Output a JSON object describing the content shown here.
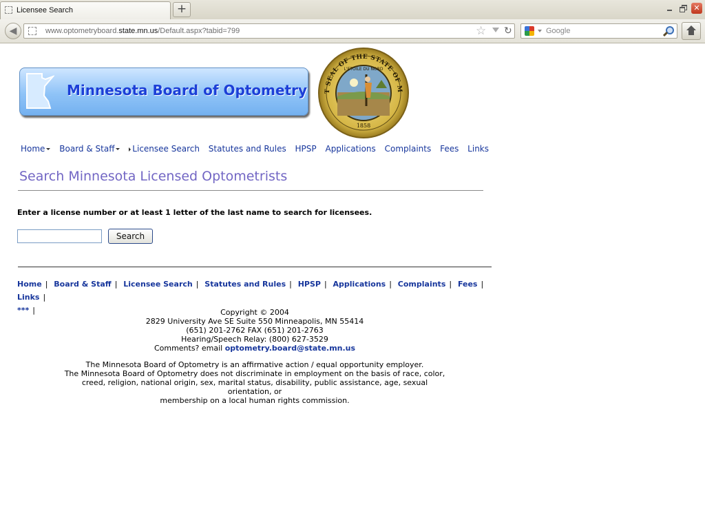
{
  "browser": {
    "tab_title": "Licensee Search",
    "new_tab": "+",
    "url_prefix": "www.optometryboard.",
    "url_host": "state.mn.us",
    "url_path": "/Default.aspx?tabid=799",
    "search_engine": "Google",
    "search_placeholder": "Google"
  },
  "banner": {
    "title": "Minnesota Board of Optometry",
    "seal_top_text": "THE GREAT SEAL OF THE STATE OF MINNESOTA",
    "seal_motto": "L'ETOILE DU NORD",
    "seal_year": "1858"
  },
  "nav": {
    "items": [
      {
        "label": "Home",
        "has_menu": true
      },
      {
        "label": "Board & Staff",
        "has_menu": true
      },
      {
        "label": "Licensee Search",
        "has_menu": false
      },
      {
        "label": "Statutes and Rules",
        "has_menu": false
      },
      {
        "label": "HPSP",
        "has_menu": false
      },
      {
        "label": "Applications",
        "has_menu": false
      },
      {
        "label": "Complaints",
        "has_menu": false
      },
      {
        "label": "Fees",
        "has_menu": false
      },
      {
        "label": "Links",
        "has_menu": false
      }
    ]
  },
  "main": {
    "title": "Search Minnesota Licensed Optometrists",
    "instructions": "Enter a license number or at least 1 letter of the last name to search for licensees.",
    "search_value": "",
    "search_button": "Search"
  },
  "footer": {
    "links": [
      "Home",
      "Board & Staff",
      "Licensee Search",
      "Statutes and Rules",
      "HPSP",
      "Applications",
      "Complaints",
      "Fees",
      "Links",
      "***"
    ],
    "copyright": "Copyright © 2004",
    "address": "2829 University Ave SE Suite 550 Minneapolis, MN 55414",
    "phone": "(651) 201-2762 FAX (651) 201-2763",
    "relay": "Hearing/Speech Relay: (800) 627-3529",
    "comments_prefix": "Comments? email ",
    "email": "optometry.board@state.mn.us",
    "eeo_line1": "The Minnesota Board of Optometry is an affirmative action / equal opportunity employer.",
    "eeo_line2": "The Minnesota Board of Optometry does not discriminate in employment on the basis of race, color,",
    "eeo_line3": "creed, religion, national origin, sex, marital status, disability, public assistance, age, sexual orientation, or",
    "eeo_line4": "membership on a local human rights commission."
  },
  "colors": {
    "link": "#17369c",
    "page_title": "#7266c4",
    "banner_title": "#1c3fd7"
  }
}
